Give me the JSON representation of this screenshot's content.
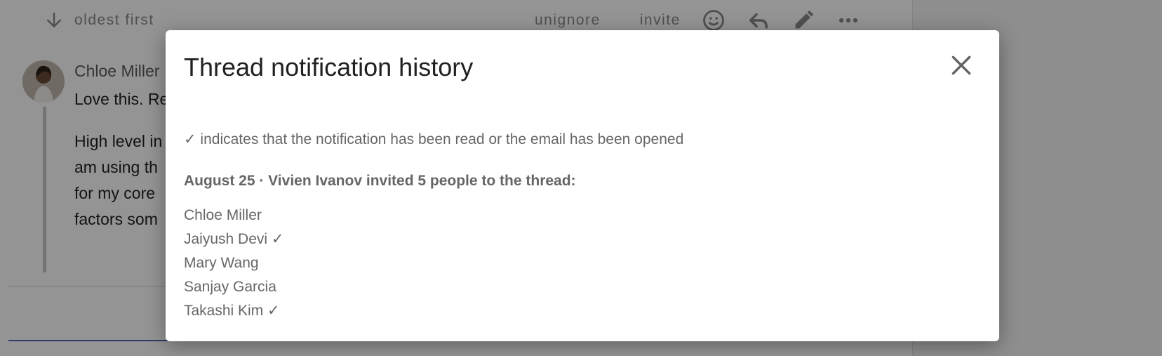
{
  "thread": {
    "sort_label": "oldest first",
    "actions": {
      "unignore_label": "unignore",
      "invite_label": "invite",
      "icons": [
        "emoji-icon",
        "reply-icon",
        "edit-icon",
        "more-icon"
      ]
    },
    "message": {
      "author": "Chloe Miller",
      "short_text": "Love this. Re",
      "long_lines": [
        "High level in",
        "am using th",
        "for my core",
        "factors som"
      ]
    }
  },
  "modal": {
    "title": "Thread notification history",
    "close_icon": "close-icon",
    "note": "✓ indicates that the notification has been read or the email has been opened",
    "event": {
      "heading": "August 25 · Vivien Ivanov invited 5 people to the thread:",
      "recipients": [
        "Chloe Miller",
        "Jaiyush Devi ✓",
        "Mary Wang",
        "Sanjay Garcia",
        "Takashi Kim ✓"
      ]
    }
  },
  "colors": {
    "overlay": "#000000",
    "accent_underline": "#4a67b2",
    "muted_text": "#666666"
  }
}
